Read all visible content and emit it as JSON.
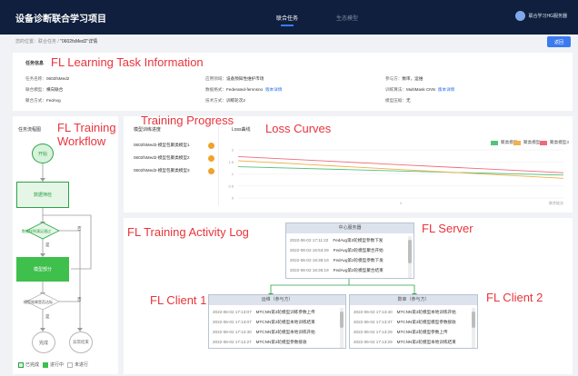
{
  "app": {
    "title": "设备诊断联合学习项目",
    "nav_tabs": [
      {
        "label": "联合任务",
        "active": true
      },
      {
        "label": "生态模型",
        "active": false
      }
    ],
    "user_name": "联合学习HG服务器"
  },
  "breadcrumb": {
    "prefix": "您的位置：联合任务 / ",
    "current": "\"0602fsMed2\"详情"
  },
  "back_button": "返回",
  "task_info": {
    "heading": "任务信息",
    "fields": [
      {
        "label": "任务名称：",
        "value": "0602fsMed2"
      },
      {
        "label": "应用领域：",
        "value": "设备预知性维护市场"
      },
      {
        "label": "参与方：",
        "value": "数审，运维"
      },
      {
        "label": "联合模型：",
        "value": "横向联合"
      },
      {
        "label": "数据格式：",
        "value": "Federated-femnsno",
        "link": "版本详情"
      },
      {
        "label": "训练算法：",
        "value": "MultiMask CNN",
        "link": "版本详情"
      },
      {
        "label": "聚合方式：",
        "value": "FedAvg"
      },
      {
        "label": "技术方式：",
        "value": "训练轮次2"
      },
      {
        "label": "模型压缩：",
        "value": "无"
      }
    ]
  },
  "annotations": {
    "learning_task": "FL Learning Task Information",
    "workflow": "FL Training\nWorkflow",
    "progress": "Training Progress",
    "loss": "Loss Curves",
    "activity_log": "FL Training Activity Log",
    "server": "FL Server",
    "client1": "FL Client 1",
    "client2": "FL Client 2"
  },
  "workflow": {
    "title": "任务流程图",
    "nodes": {
      "start": "开始",
      "data_prep": "数据筛检",
      "decision1": "数据样例满足通过",
      "train": "模型部分",
      "decision2": "模型效果是否达标",
      "done": "完成",
      "abnormal": "异常结束"
    },
    "yes_label": "是",
    "no_label": "否",
    "legend": [
      {
        "label": "已完成",
        "state": "done"
      },
      {
        "label": "进行中",
        "state": "running"
      },
      {
        "label": "未进行",
        "state": "todo"
      }
    ]
  },
  "progress": {
    "title": "模型训练进度",
    "items": [
      {
        "label": "0602fsMed2-模型包聚类模型1",
        "status_color": "#f0a22b"
      },
      {
        "label": "0602fsMed2-模型包聚类模型2",
        "status_color": "#f0a22b"
      },
      {
        "label": "0602fsMed2-模型包聚类模型3",
        "status_color": "#f0a22b"
      }
    ]
  },
  "chart_data": {
    "type": "line",
    "title": "Loss曲线",
    "x": [
      0,
      1,
      2
    ],
    "x_ticks": [
      "0",
      "1",
      "2"
    ],
    "x_tick_last": "联合轮次",
    "y_ticks": [
      "2",
      "1.5",
      "1",
      "0.5",
      "0"
    ],
    "ylim": [
      0,
      2
    ],
    "grid": true,
    "legend_position": "top-right",
    "series": [
      {
        "name": "聚类模型1",
        "color": "#52c47a",
        "values": [
          1.3,
          1.12,
          0.95
        ]
      },
      {
        "name": "聚类模型2",
        "color": "#f2b04c",
        "values": [
          1.55,
          1.18,
          0.82
        ]
      },
      {
        "name": "聚类模型3",
        "color": "#ef6a7a",
        "values": [
          1.72,
          1.38,
          1.05
        ]
      }
    ]
  },
  "logs": {
    "server": {
      "title": "中心服务器",
      "rows": [
        {
          "time": "2022-06-02 17:11:22",
          "text": "FedAvg第3轮模型参数下发"
        },
        {
          "time": "2022-06-02 16:53:29",
          "text": "FedAvg第3轮模型聚合开始"
        },
        {
          "time": "2022-06-02 16:38:19",
          "text": "FedAvg第2轮模型参数下发"
        },
        {
          "time": "2022-06-02 16:36:19",
          "text": "FedAvg第2轮模型聚合结束"
        }
      ]
    },
    "client1": {
      "title": "运维（参与方）",
      "rows": [
        {
          "time": "2022-06-02 17:13:07",
          "text": "MTCNN第3轮模型训练参数上传"
        },
        {
          "time": "2022-06-02 17:13:07",
          "text": "MTCNN第3轮模型本地训练结束"
        },
        {
          "time": "2022-06-02 17:12:30",
          "text": "MTCNN第3轮模型本地训练开始"
        },
        {
          "time": "2022-06-02 17:12:27",
          "text": "MTCNN第3轮模型参数接收"
        }
      ]
    },
    "client2": {
      "title": "数审（参与方）",
      "rows": [
        {
          "time": "2022-06-02 17:13:40",
          "text": "MTCNN第3轮模型本地训练开始"
        },
        {
          "time": "2022-06-02 17:13:37",
          "text": "MTCNN第3轮模型模型参数接收"
        },
        {
          "time": "2022-06-02 17:13:29",
          "text": "MTCNN第2轮模型参数上传"
        },
        {
          "time": "2022-06-02 17:13:29",
          "text": "MTCNN第2轮模型本地训练结束"
        }
      ]
    }
  }
}
